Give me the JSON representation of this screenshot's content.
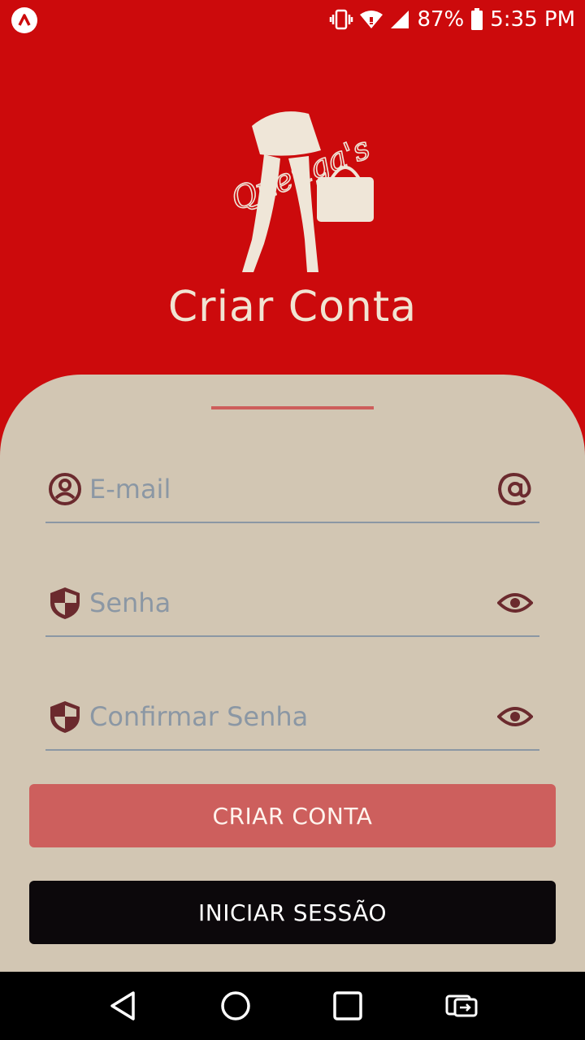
{
  "status_bar": {
    "battery": "87%",
    "time": "5:35 PM"
  },
  "header": {
    "logo_text": "Quenga's",
    "title": "Criar Conta"
  },
  "form": {
    "email": {
      "placeholder": "E-mail",
      "value": ""
    },
    "password": {
      "placeholder": "Senha",
      "value": ""
    },
    "confirm_password": {
      "placeholder": "Confirmar Senha",
      "value": ""
    }
  },
  "buttons": {
    "create_account": "CRIAR CONTA",
    "sign_in": "INICIAR SESSÃO"
  },
  "colors": {
    "primary_red": "#cc0a0c",
    "card_beige": "#d2c6b3",
    "accent": "#cd5f5d",
    "icon_brown": "#6b2a2e",
    "dark_button": "#0c080b"
  }
}
